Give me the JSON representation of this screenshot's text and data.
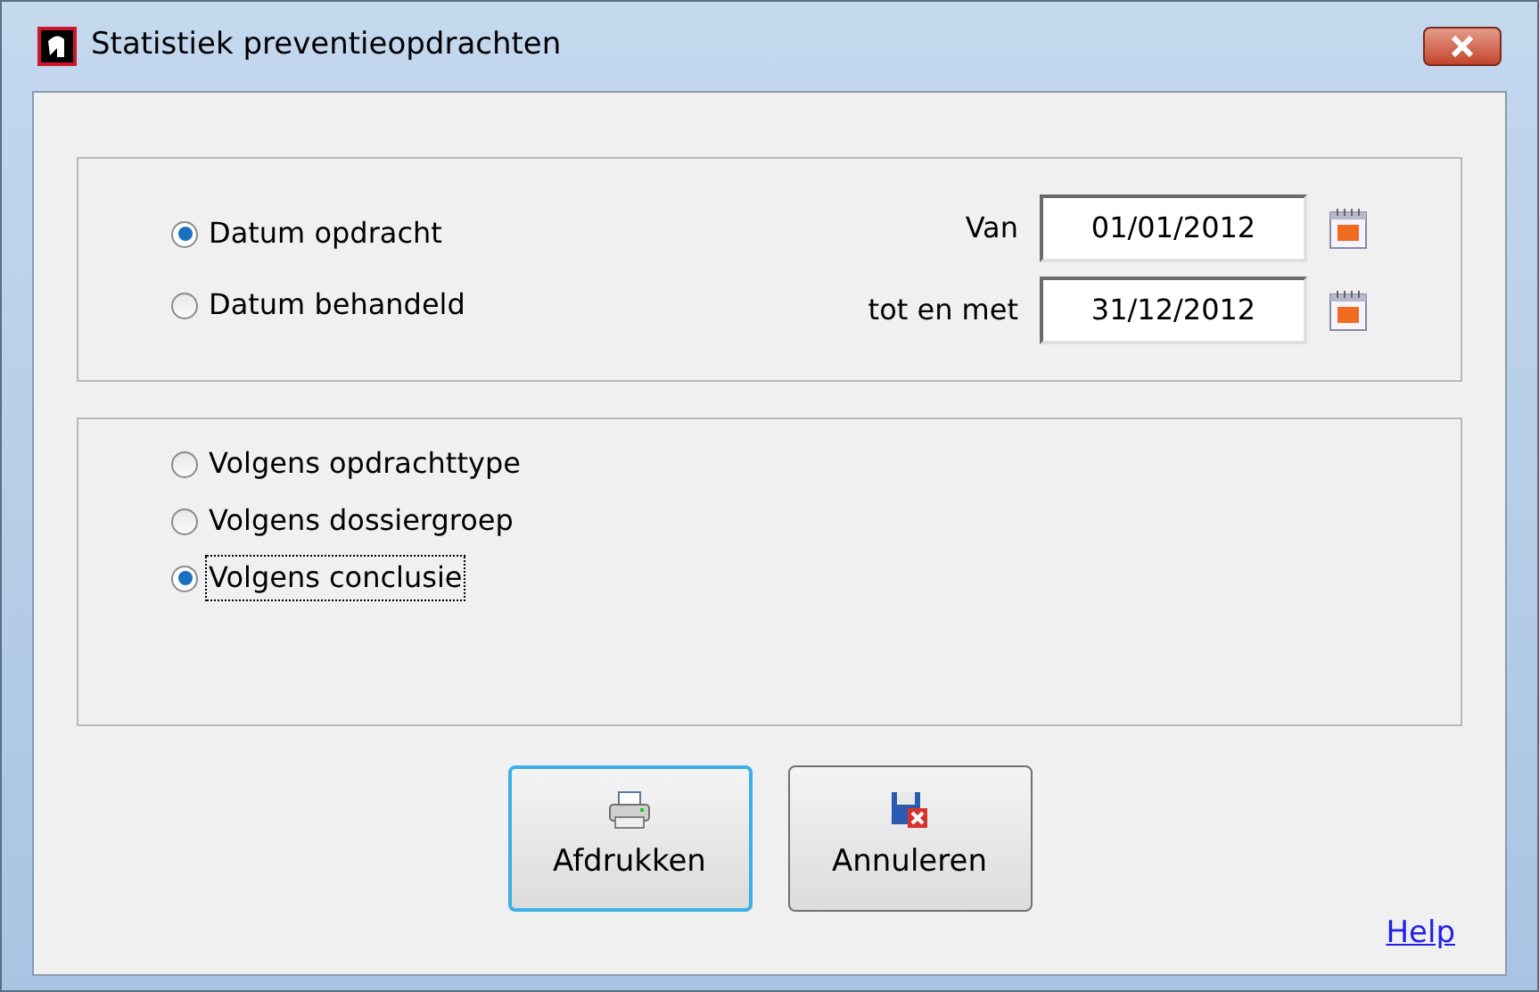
{
  "window": {
    "title": "Statistiek preventieopdrachten"
  },
  "date_type": [
    {
      "label": "Datum opdracht",
      "selected": true
    },
    {
      "label": "Datum behandeld",
      "selected": false
    }
  ],
  "date_range": [
    {
      "label": "Van",
      "value": "01/01/2012"
    },
    {
      "label": "tot en met",
      "value": "31/12/2012"
    }
  ],
  "grouping": [
    {
      "label": "Volgens opdrachttype",
      "selected": false,
      "focused": false
    },
    {
      "label": "Volgens dossiergroep",
      "selected": false,
      "focused": false
    },
    {
      "label": "Volgens conclusie",
      "selected": true,
      "focused": true
    }
  ],
  "buttons": [
    {
      "label": "Afdrukken",
      "kind": "print",
      "default": true
    },
    {
      "label": "Annuleren",
      "kind": "cancel",
      "default": false
    }
  ],
  "help_link": "Help"
}
